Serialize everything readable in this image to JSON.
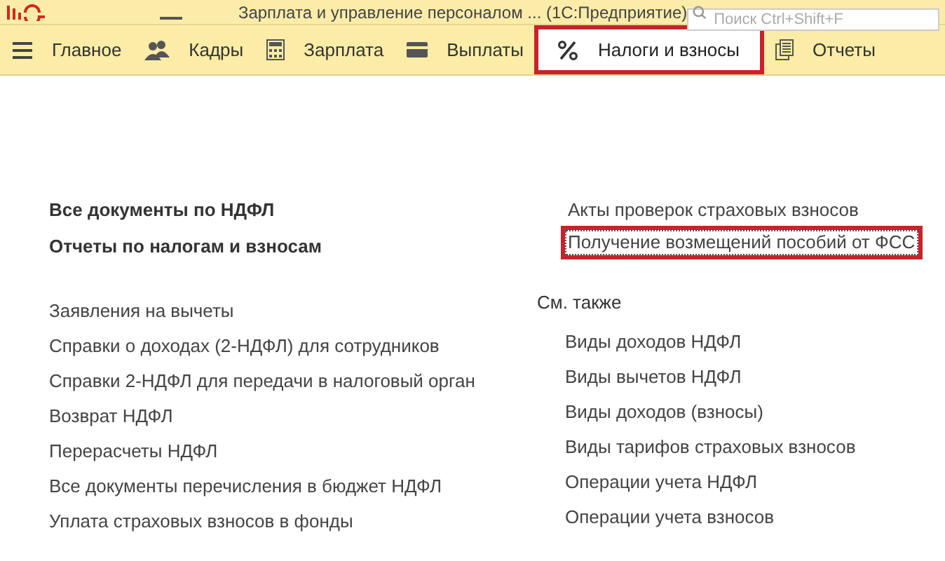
{
  "window": {
    "title": "Зарплата и управление персоналом ... (1С:Предприятие)"
  },
  "search": {
    "placeholder": "Поиск Ctrl+Shift+F"
  },
  "sections": [
    {
      "label": "Главное",
      "selected": false,
      "highlighted": false
    },
    {
      "label": "Кадры",
      "selected": false,
      "highlighted": false
    },
    {
      "label": "Зарплата",
      "selected": false,
      "highlighted": false
    },
    {
      "label": "Выплаты",
      "selected": false,
      "highlighted": false
    },
    {
      "label": "Налоги и взносы",
      "selected": true,
      "highlighted": true
    },
    {
      "label": "Отчеты",
      "selected": false,
      "highlighted": false
    }
  ],
  "left_panel": {
    "main_links": [
      {
        "label": "Все документы по НДФЛ"
      },
      {
        "label": "Отчеты по налогам и взносам"
      }
    ],
    "links": [
      {
        "label": "Заявления на вычеты"
      },
      {
        "label": "Справки о доходах (2-НДФЛ) для сотрудников"
      },
      {
        "label": "Справки 2-НДФЛ для передачи в налоговый орган"
      },
      {
        "label": "Возврат НДФЛ"
      },
      {
        "label": "Перерасчеты НДФЛ"
      },
      {
        "label": "Все документы перечисления в бюджет НДФЛ"
      },
      {
        "label": "Уплата страховых взносов в фонды"
      }
    ]
  },
  "right_panel": {
    "links": [
      {
        "label": "Акты проверок страховых взносов",
        "highlighted": false
      },
      {
        "label": "Получение возмещений пособий от ФСС",
        "highlighted": true
      }
    ],
    "see_also": {
      "title": "См. также",
      "links": [
        {
          "label": "Виды доходов НДФЛ"
        },
        {
          "label": "Виды вычетов НДФЛ"
        },
        {
          "label": "Виды доходов (взносы)"
        },
        {
          "label": "Виды тарифов страховых взносов"
        },
        {
          "label": "Операции учета НДФЛ"
        },
        {
          "label": "Операции учета взносов"
        }
      ]
    }
  }
}
